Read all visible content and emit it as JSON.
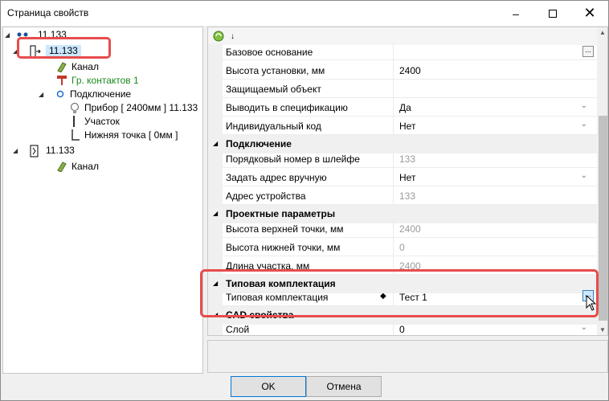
{
  "window": {
    "title": "Страница свойств",
    "minimize": "–",
    "close": "✕"
  },
  "tree": {
    "items": [
      {
        "label": "11.133",
        "toggle": "◢"
      },
      {
        "label": "11.133",
        "toggle": "◢"
      },
      {
        "label": "Канал"
      },
      {
        "label": "Гр. контактов 1"
      },
      {
        "label": "Подключение",
        "toggle": "◢"
      },
      {
        "label": "Прибор [ 2400мм ] 11.133"
      },
      {
        "label": "Участок"
      },
      {
        "label": "Нижняя точка [ 0мм ]"
      },
      {
        "label": "11.133",
        "toggle": "◢"
      },
      {
        "label": "Канал"
      }
    ]
  },
  "grid": {
    "toolbar_sort": "↓",
    "rows": [
      {
        "name": "Базовое основание",
        "value": "",
        "dots": "..."
      },
      {
        "name": "Высота установки, мм",
        "value": "2400"
      },
      {
        "name": "Защищаемый объект",
        "value": ""
      },
      {
        "name": "Выводить в спецификацию",
        "value": "Да",
        "chev": "⌄"
      },
      {
        "name": "Индивидуальный код",
        "value": "Нет",
        "chev": "⌄"
      },
      {
        "category": "Подключение"
      },
      {
        "name": "Порядковый номер в шлейфе",
        "value": "133"
      },
      {
        "name": "Задать адрес вручную",
        "value": "Нет",
        "chev": "⌄"
      },
      {
        "name": "Адрес устройства",
        "value": "133"
      },
      {
        "category": "Проектные параметры"
      },
      {
        "name": "Высота верхней точки, мм",
        "value": "2400"
      },
      {
        "name": "Высота нижней точки, мм",
        "value": "0"
      },
      {
        "name": "Длина участка, мм",
        "value": "2400"
      },
      {
        "category": "Типовая комплектация"
      },
      {
        "name": "Типовая комплектация",
        "value": "Тест 1",
        "marker": "◆",
        "dots": "..."
      },
      {
        "category": "CAD свойства"
      },
      {
        "name": "Слой",
        "value": "0",
        "chev": "⌄"
      }
    ],
    "category_toggle": "◢",
    "scroll_up": "▲",
    "scroll_down": "▼"
  },
  "buttons": {
    "ok": "OK",
    "cancel": "Отмена"
  },
  "colors": {
    "highlight": "#e74c4c",
    "selection": "#cce8ff",
    "green_text": "#1a8a1a"
  }
}
